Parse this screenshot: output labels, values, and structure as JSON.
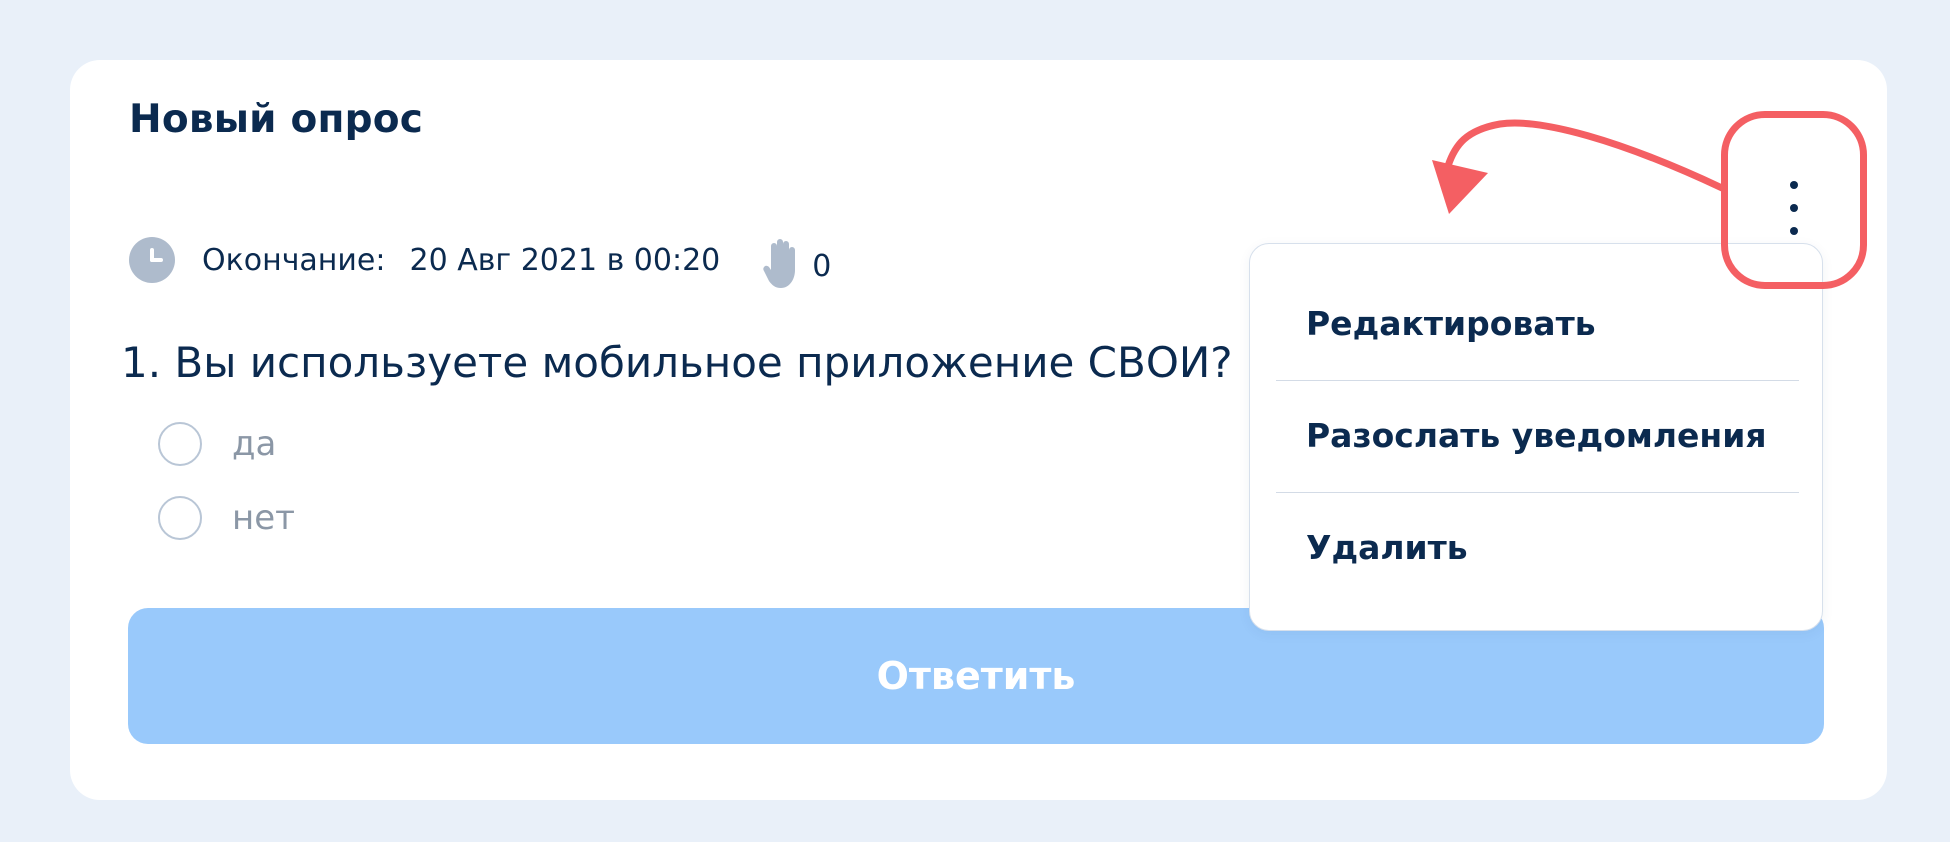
{
  "poll": {
    "title": "Новый опрос",
    "end_label": "Окончание:",
    "end_date": "20 Авг 2021 в 00:20",
    "votes_count": "0",
    "question": "1. Вы используете мобильное приложение СВОИ?",
    "options": [
      {
        "label": "да"
      },
      {
        "label": "нет"
      }
    ],
    "answer_button_label": "Ответить"
  },
  "menu": {
    "items": [
      {
        "label": "Редактировать"
      },
      {
        "label": "Разослать уведомления"
      },
      {
        "label": "Удалить"
      }
    ]
  },
  "icons": {
    "clock": "clock-icon",
    "votes": "raised-hand-icon",
    "more": "more-vertical-icon"
  },
  "colors": {
    "background": "#e9f0f9",
    "card": "#ffffff",
    "text_primary": "#0b2a4f",
    "text_muted": "#8b97a6",
    "button_disabled": "#99c9fb",
    "annotation": "#f45f63"
  }
}
